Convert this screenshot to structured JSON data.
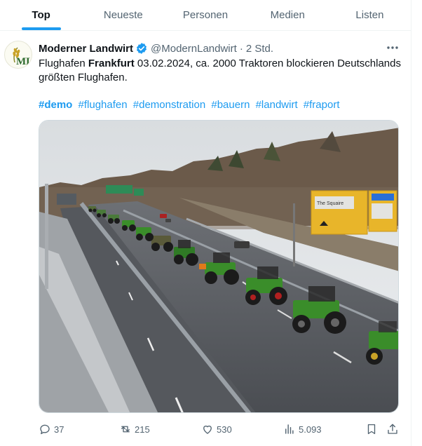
{
  "tabs": [
    {
      "label": "Top",
      "active": true
    },
    {
      "label": "Neueste",
      "active": false
    },
    {
      "label": "Personen",
      "active": false
    },
    {
      "label": "Medien",
      "active": false
    },
    {
      "label": "Listen",
      "active": false
    }
  ],
  "tweet": {
    "author_name": "Moderner Landwirt",
    "avatar_text": "ML",
    "handle": "@ModernLandwirt",
    "separator": "·",
    "time": "2 Std.",
    "text_before": "Flughafen ",
    "text_bold": "Frankfurt",
    "text_after": " 03.02.2024, ca. 2000 Traktoren blockieren Deutschlands größten Flughafen.",
    "hashtags": [
      "#demo",
      "#flughafen",
      "#demonstration",
      "#bauern",
      "#landwirt",
      "#fraport"
    ],
    "image_alt": "Tractors on motorway near Frankfurt airport",
    "sign_text": "The Squaire"
  },
  "actions": {
    "replies": "37",
    "reposts": "215",
    "likes": "530",
    "views": "5.093"
  },
  "icons": [
    "verified-badge-icon",
    "more-icon",
    "reply-icon",
    "repost-icon",
    "like-icon",
    "views-icon",
    "bookmark-icon",
    "share-icon"
  ],
  "colors": {
    "accent": "#1d9bf0",
    "text": "#0f1419",
    "muted": "#536471",
    "border": "#eff3f4"
  }
}
